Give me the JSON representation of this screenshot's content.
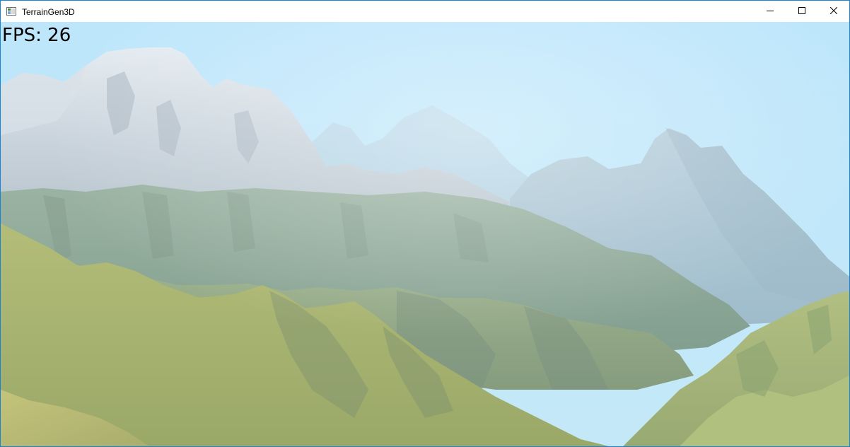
{
  "window": {
    "title": "TerrainGen3D",
    "controls": {
      "minimize": "minimize-icon",
      "maximize": "maximize-icon",
      "close": "close-icon"
    },
    "accent_border": "#1883d7"
  },
  "viewport": {
    "fps_text": "FPS: 26",
    "sky_color": "#bfe7fb",
    "terrain_colors": {
      "grass": "#a7b26a",
      "grass_shadow": "#6f8a72",
      "snow": "#d4dde6",
      "far_mountains": "#a9c7d8"
    }
  }
}
